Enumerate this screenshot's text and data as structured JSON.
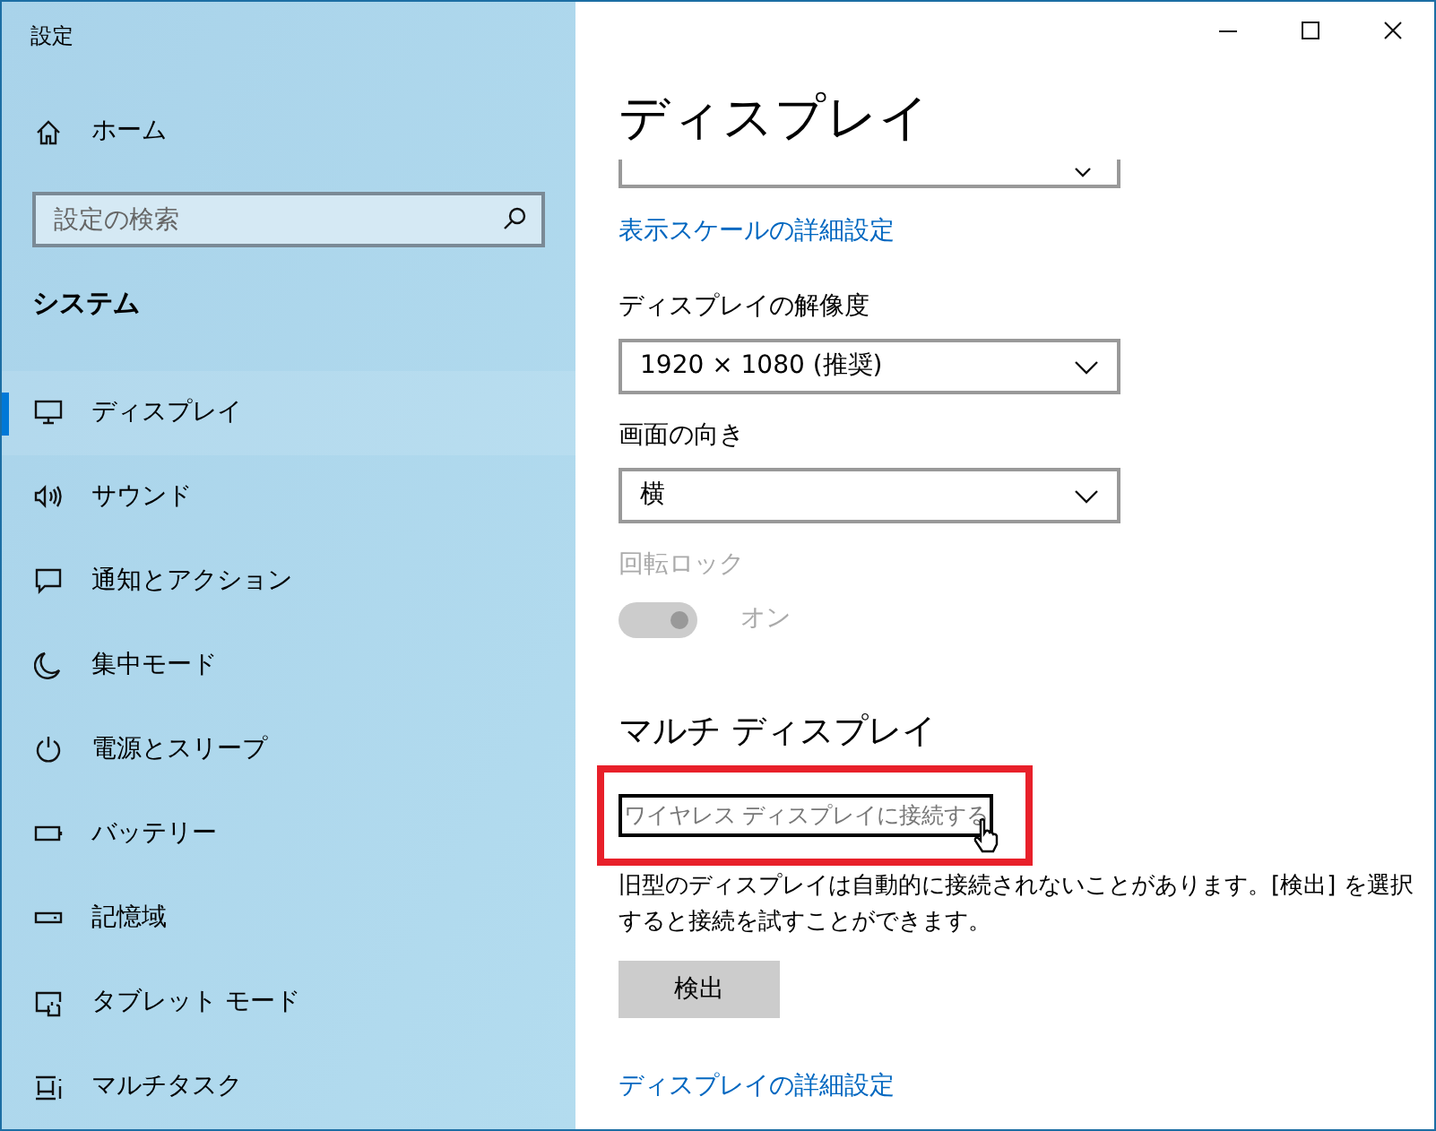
{
  "window": {
    "title": "設定"
  },
  "sidebar": {
    "home": {
      "label": "ホーム"
    },
    "search": {
      "placeholder": "設定の検索"
    },
    "section": "システム",
    "items": [
      {
        "label": "ディスプレイ",
        "selected": true
      },
      {
        "label": "サウンド",
        "selected": false
      },
      {
        "label": "通知とアクション",
        "selected": false
      },
      {
        "label": "集中モード",
        "selected": false
      },
      {
        "label": "電源とスリープ",
        "selected": false
      },
      {
        "label": "バッテリー",
        "selected": false
      },
      {
        "label": "記憶域",
        "selected": false
      },
      {
        "label": "タブレット モード",
        "selected": false
      },
      {
        "label": "マルチタスク",
        "selected": false
      }
    ]
  },
  "content": {
    "title": "ディスプレイ",
    "scaling_link": "表示スケールの詳細設定",
    "resolution": {
      "label": "ディスプレイの解像度",
      "value": "1920 × 1080 (推奨)"
    },
    "orientation": {
      "label": "画面の向き",
      "value": "横"
    },
    "rotation_lock": {
      "label": "回転ロック",
      "on": true,
      "disabled": true,
      "state_text": "オン"
    },
    "multi_display": {
      "heading": "マルチ ディスプレイ",
      "wireless_link": {
        "label": "ワイヤレス ディスプレイに接続する",
        "highlighted": true
      },
      "description": "旧型のディスプレイは自動的に接続されないことがあります。[検出] を選択すると接続を試すことができます。",
      "detect_button": "検出",
      "advanced_link": "ディスプレイの詳細設定"
    }
  }
}
